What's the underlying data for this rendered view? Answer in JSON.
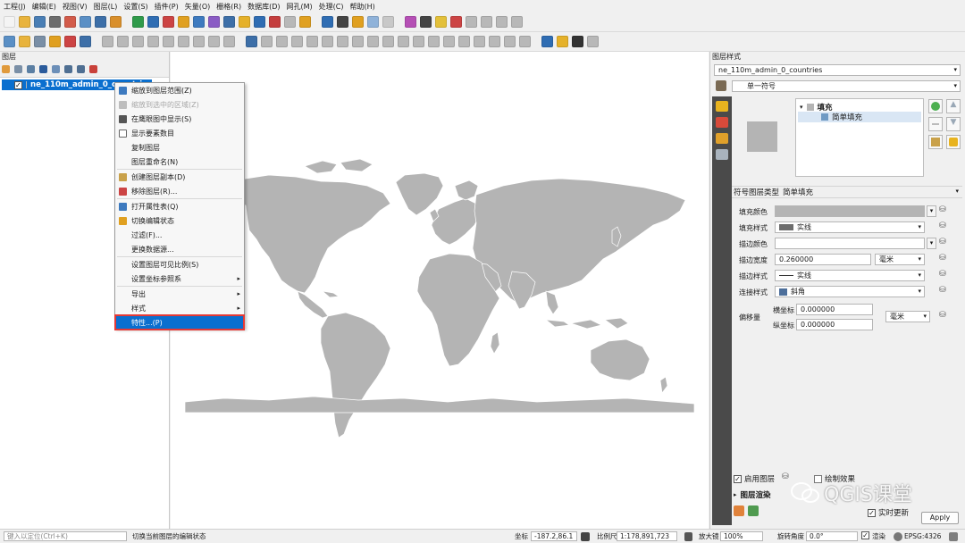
{
  "menubar": [
    "工程(J)",
    "编辑(E)",
    "视图(V)",
    "图层(L)",
    "设置(S)",
    "插件(P)",
    "矢量(O)",
    "栅格(R)",
    "数据库(D)",
    "网孔(M)",
    "处理(C)",
    "帮助(H)"
  ],
  "layers_panel": {
    "title": "图层",
    "layer_name": "ne_110m_admin_0_countries",
    "layer_checked": "✓"
  },
  "context_menu": {
    "items": [
      {
        "label": "缩放到图层范围(Z)",
        "icon": "zoom-layer-icon",
        "disabled": false
      },
      {
        "label": "缩放到选中的区域(Z)",
        "icon": "zoom-selection-icon",
        "disabled": true
      },
      {
        "label": "在鹰眼图中显示(S)",
        "icon": "overview-icon",
        "disabled": false
      },
      {
        "label": "显示要素数目",
        "icon": "checkbox-icon",
        "disabled": false
      },
      {
        "label": "复制图层",
        "icon": "",
        "disabled": false
      },
      {
        "label": "图层重命名(N)",
        "icon": "",
        "disabled": false
      },
      {
        "label": "创建图层副本(D)",
        "icon": "duplicate-icon",
        "disabled": false
      },
      {
        "label": "移除图层(R)...",
        "icon": "remove-layer-icon",
        "disabled": false
      },
      {
        "label": "打开属性表(Q)",
        "icon": "attribute-table-icon",
        "disabled": false
      },
      {
        "label": "切换编辑状态",
        "icon": "pencil-icon",
        "disabled": false
      },
      {
        "label": "过滤(F)...",
        "icon": "",
        "disabled": false
      },
      {
        "label": "更换数据源...",
        "icon": "",
        "disabled": false
      },
      {
        "label": "设置图层可见比例(S)",
        "icon": "",
        "disabled": false
      },
      {
        "label": "设置坐标参照系",
        "icon": "",
        "disabled": false,
        "submenu": true
      },
      {
        "label": "导出",
        "icon": "",
        "disabled": false,
        "submenu": true
      },
      {
        "label": "样式",
        "icon": "",
        "disabled": false,
        "submenu": true
      },
      {
        "label": "特性...(P)",
        "icon": "",
        "disabled": false,
        "active": true
      }
    ],
    "arrow": "▸"
  },
  "style_panel": {
    "title": "图层样式",
    "layer_combo": "ne_110m_admin_0_countries",
    "renderer": "单一符号",
    "tree_fill": "填充",
    "tree_simple_fill": "简单填充",
    "symbol_layer_type_label": "符号图层类型",
    "symbol_layer_type": "简单填充",
    "fill_color_label": "填充颜色",
    "fill_style_label": "填充样式",
    "fill_style_value": "实线",
    "stroke_color_label": "描边颜色",
    "stroke_width_label": "描边宽度",
    "stroke_width_value": "0.260000",
    "stroke_width_unit": "毫米",
    "stroke_style_label": "描边样式",
    "stroke_style_value": "实线",
    "join_style_label": "连接样式",
    "join_style_value": "斜角",
    "offset_label": "偏移量",
    "offset_x_label": "横坐标",
    "offset_x_value": "0.000000",
    "offset_y_label": "纵坐标",
    "offset_y_value": "0.000000",
    "offset_unit": "毫米",
    "enable_layer": "启用图层",
    "draw_effects": "绘制效果",
    "layer_rendering": "图层渲染",
    "live_update": "实时更新",
    "apply": "Apply",
    "fill_color": "#b4b4b4",
    "check": "✓",
    "arrow_down": "▾",
    "tri_right": "▸"
  },
  "statusbar": {
    "locate_placeholder": "键入以定位(Ctrl+K)",
    "message": "切换当前图层的编辑状态",
    "coord_label": "坐标",
    "coord_value": "-187.2,86.1",
    "scale_label": "比例尺",
    "scale_value": "1:178,891,723",
    "magnifier_label": "放大镜",
    "magnifier_value": "100%",
    "rotation_label": "旋转角度",
    "rotation_value": "0.0°",
    "render_label": "渲染",
    "crs": "EPSG:4326",
    "check": "✓"
  },
  "watermark": {
    "text": "QGIS课堂"
  },
  "colors": {
    "accent": "#0a6fcf",
    "land": "#b4b4b4",
    "highlight_border": "#e53935"
  }
}
